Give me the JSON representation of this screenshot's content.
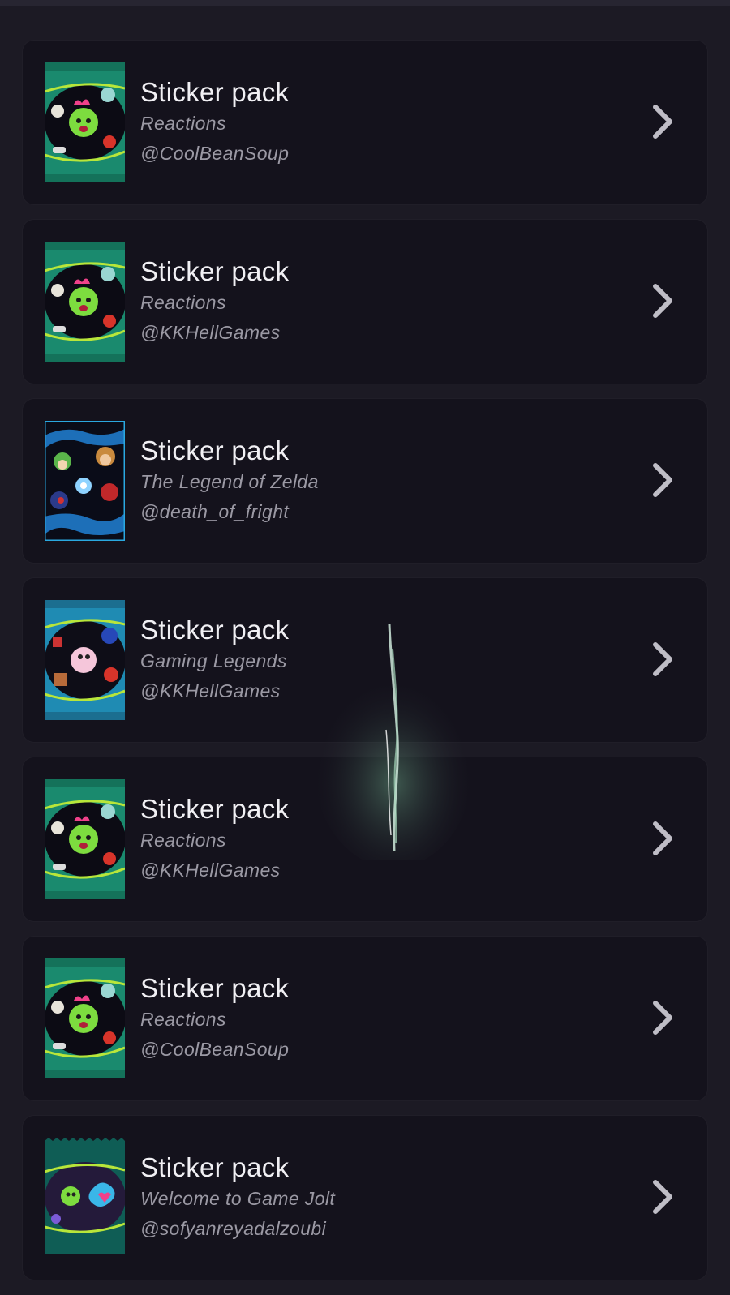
{
  "colors": {
    "background": "#1c1a24",
    "card": "#14121c",
    "title": "#f1f0f4",
    "secondary": "#9b99a4",
    "chevron": "#bfbdc6"
  },
  "list": {
    "items": [
      {
        "title": "Sticker pack",
        "subtitle": "Reactions",
        "author": "@CoolBeanSoup",
        "pack_color": "#1a8a6e",
        "pack_style": "reactions"
      },
      {
        "title": "Sticker pack",
        "subtitle": "Reactions",
        "author": "@KKHellGames",
        "pack_color": "#1a8a6e",
        "pack_style": "reactions"
      },
      {
        "title": "Sticker pack",
        "subtitle": "The Legend of Zelda",
        "author": "@death_of_fright",
        "pack_color": "#2aa8e0",
        "pack_style": "zelda"
      },
      {
        "title": "Sticker pack",
        "subtitle": "Gaming Legends",
        "author": "@KKHellGames",
        "pack_color": "#1f8bb3",
        "pack_style": "legends"
      },
      {
        "title": "Sticker pack",
        "subtitle": "Reactions",
        "author": "@KKHellGames",
        "pack_color": "#1a8a6e",
        "pack_style": "reactions"
      },
      {
        "title": "Sticker pack",
        "subtitle": "Reactions",
        "author": "@CoolBeanSoup",
        "pack_color": "#1a8a6e",
        "pack_style": "reactions"
      },
      {
        "title": "Sticker pack",
        "subtitle": "Welcome to Game Jolt",
        "author": "@sofyanreyadalzoubi",
        "pack_color": "#0f5d55",
        "pack_style": "welcome"
      }
    ]
  },
  "icons": {
    "chevron": "chevron-right-icon",
    "pack": "sticker-pack-icon"
  }
}
